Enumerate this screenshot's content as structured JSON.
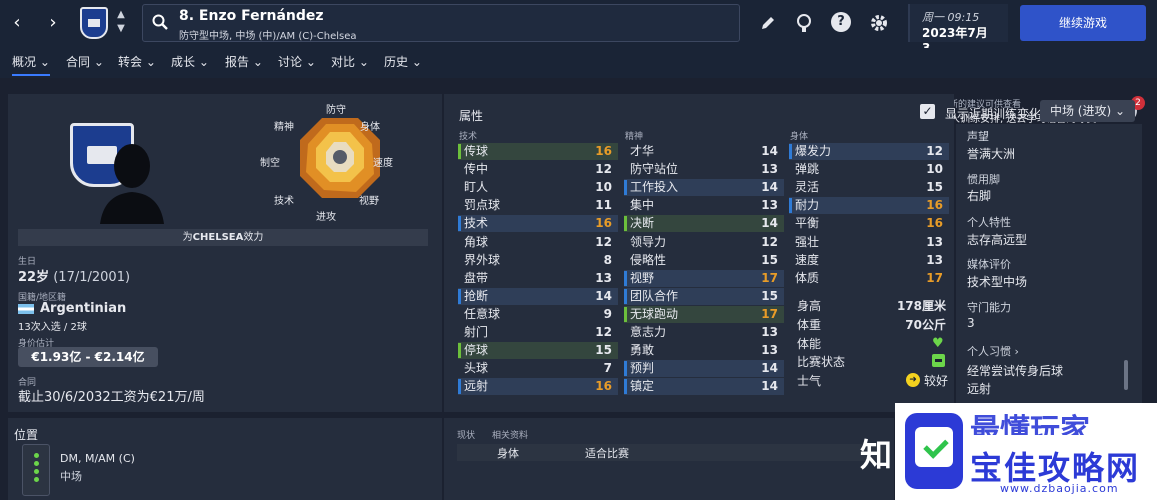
{
  "top": {
    "player_name": "8. Enzo Fernández",
    "player_sub": "防守型中场, 中场 (中)/AM (C)-Chelsea",
    "date_line1": "周一 09:15",
    "date_line2": "2023年7月3...",
    "continue_label": "继续游戏",
    "help_label": "?"
  },
  "menu": [
    "概况",
    "合同",
    "转会",
    "成长",
    "报告",
    "讨论",
    "对比",
    "历史"
  ],
  "notification": {
    "line1": "有新的建议可供查看",
    "line2": "个人训练安排, 送去学习语言的球员",
    "count": "2"
  },
  "radar": {
    "labels": [
      "防守",
      "身体",
      "速度",
      "视野",
      "进攻",
      "技术",
      "制空",
      "精神"
    ]
  },
  "profile": {
    "plays_for_prefix": "为",
    "plays_for_club": "CHELSEA",
    "plays_for_suffix": "效力",
    "birth_label": "生日",
    "age": "22岁",
    "birth_date": "(17/1/2001)",
    "nation_label": "国籍/地区籍",
    "nation": "Argentinian",
    "caps": "13次入选 / 2球",
    "value_label": "身价估计",
    "value": "€1.93亿 - €2.14亿",
    "contract_label": "合同",
    "contract": "截止30/6/2032工资为€21万/周"
  },
  "attributes": {
    "title": "属性",
    "show_training": "显示近期训练变化",
    "position_select": "中场 (进攻)",
    "technical_label": "技术",
    "mental_label": "精神",
    "physical_label": "身体",
    "technical": [
      {
        "n": "传球",
        "v": "16",
        "hl": "g",
        "c": "#e89c28"
      },
      {
        "n": "传中",
        "v": "12",
        "hl": "",
        "c": "#e6e8ee"
      },
      {
        "n": "盯人",
        "v": "10",
        "hl": "",
        "c": "#e6e8ee"
      },
      {
        "n": "罚点球",
        "v": "11",
        "hl": "",
        "c": "#e6e8ee"
      },
      {
        "n": "技术",
        "v": "16",
        "hl": "b",
        "c": "#e89c28"
      },
      {
        "n": "角球",
        "v": "12",
        "hl": "",
        "c": "#e6e8ee"
      },
      {
        "n": "界外球",
        "v": "8",
        "hl": "",
        "c": "#e6e8ee"
      },
      {
        "n": "盘带",
        "v": "13",
        "hl": "",
        "c": "#e6e8ee"
      },
      {
        "n": "抢断",
        "v": "14",
        "hl": "b",
        "c": "#e6e8ee"
      },
      {
        "n": "任意球",
        "v": "9",
        "hl": "",
        "c": "#e6e8ee"
      },
      {
        "n": "射门",
        "v": "12",
        "hl": "",
        "c": "#e6e8ee"
      },
      {
        "n": "停球",
        "v": "15",
        "hl": "g",
        "c": "#e6e8ee"
      },
      {
        "n": "头球",
        "v": "7",
        "hl": "",
        "c": "#e6e8ee"
      },
      {
        "n": "远射",
        "v": "16",
        "hl": "b",
        "c": "#e89c28"
      }
    ],
    "mental": [
      {
        "n": "才华",
        "v": "14",
        "hl": "",
        "c": "#e6e8ee"
      },
      {
        "n": "防守站位",
        "v": "13",
        "hl": "",
        "c": "#e6e8ee"
      },
      {
        "n": "工作投入",
        "v": "14",
        "hl": "b",
        "c": "#e6e8ee"
      },
      {
        "n": "集中",
        "v": "13",
        "hl": "",
        "c": "#e6e8ee"
      },
      {
        "n": "决断",
        "v": "14",
        "hl": "g",
        "c": "#e6e8ee"
      },
      {
        "n": "领导力",
        "v": "12",
        "hl": "",
        "c": "#e6e8ee"
      },
      {
        "n": "侵略性",
        "v": "15",
        "hl": "",
        "c": "#e6e8ee"
      },
      {
        "n": "视野",
        "v": "17",
        "hl": "b",
        "c": "#e89c28"
      },
      {
        "n": "团队合作",
        "v": "15",
        "hl": "b",
        "c": "#e6e8ee"
      },
      {
        "n": "无球跑动",
        "v": "17",
        "hl": "g",
        "c": "#e89c28"
      },
      {
        "n": "意志力",
        "v": "13",
        "hl": "",
        "c": "#e6e8ee"
      },
      {
        "n": "勇敢",
        "v": "13",
        "hl": "",
        "c": "#e6e8ee"
      },
      {
        "n": "预判",
        "v": "14",
        "hl": "b",
        "c": "#e6e8ee"
      },
      {
        "n": "镇定",
        "v": "14",
        "hl": "b",
        "c": "#e6e8ee"
      }
    ],
    "physical": [
      {
        "n": "爆发力",
        "v": "12",
        "hl": "b",
        "c": "#e6e8ee"
      },
      {
        "n": "弹跳",
        "v": "10",
        "hl": "",
        "c": "#e6e8ee"
      },
      {
        "n": "灵活",
        "v": "15",
        "hl": "",
        "c": "#e6e8ee"
      },
      {
        "n": "耐力",
        "v": "16",
        "hl": "b",
        "c": "#e89c28"
      },
      {
        "n": "平衡",
        "v": "16",
        "hl": "",
        "c": "#e89c28"
      },
      {
        "n": "强壮",
        "v": "13",
        "hl": "",
        "c": "#e6e8ee"
      },
      {
        "n": "速度",
        "v": "13",
        "hl": "",
        "c": "#e6e8ee"
      },
      {
        "n": "体质",
        "v": "17",
        "hl": "",
        "c": "#e89c28"
      }
    ],
    "height_label": "身高",
    "height": "178厘米",
    "weight_label": "体重",
    "weight": "70公斤",
    "fitness_label": "体能",
    "match_label": "比赛状态",
    "morale_label": "士气",
    "morale": "较好"
  },
  "right": {
    "rep_label": "声望",
    "rep": "誉满大洲",
    "foot_label": "惯用脚",
    "foot": "右脚",
    "personality_label": "个人特性",
    "personality": "志存高远型",
    "media_label": "媒体评价",
    "media": "技术型中场",
    "gk_label": "守门能力",
    "gk": "3",
    "habits_label": "个人习惯",
    "habit1": "经常尝试传身后球",
    "habit2": "远射",
    "habit3": "..."
  },
  "bottom": {
    "position_label": "位置",
    "positions": "DM, M/AM (C)",
    "position_sub": "中场",
    "status_label": "现状",
    "related_label": "相关资料",
    "body_label": "身体",
    "fit_label": "适合比赛"
  },
  "watermark": {
    "char": "知",
    "text": "宝佳攻略网",
    "top": "最懂玩家",
    "url": "www.dzbaojia.com"
  }
}
